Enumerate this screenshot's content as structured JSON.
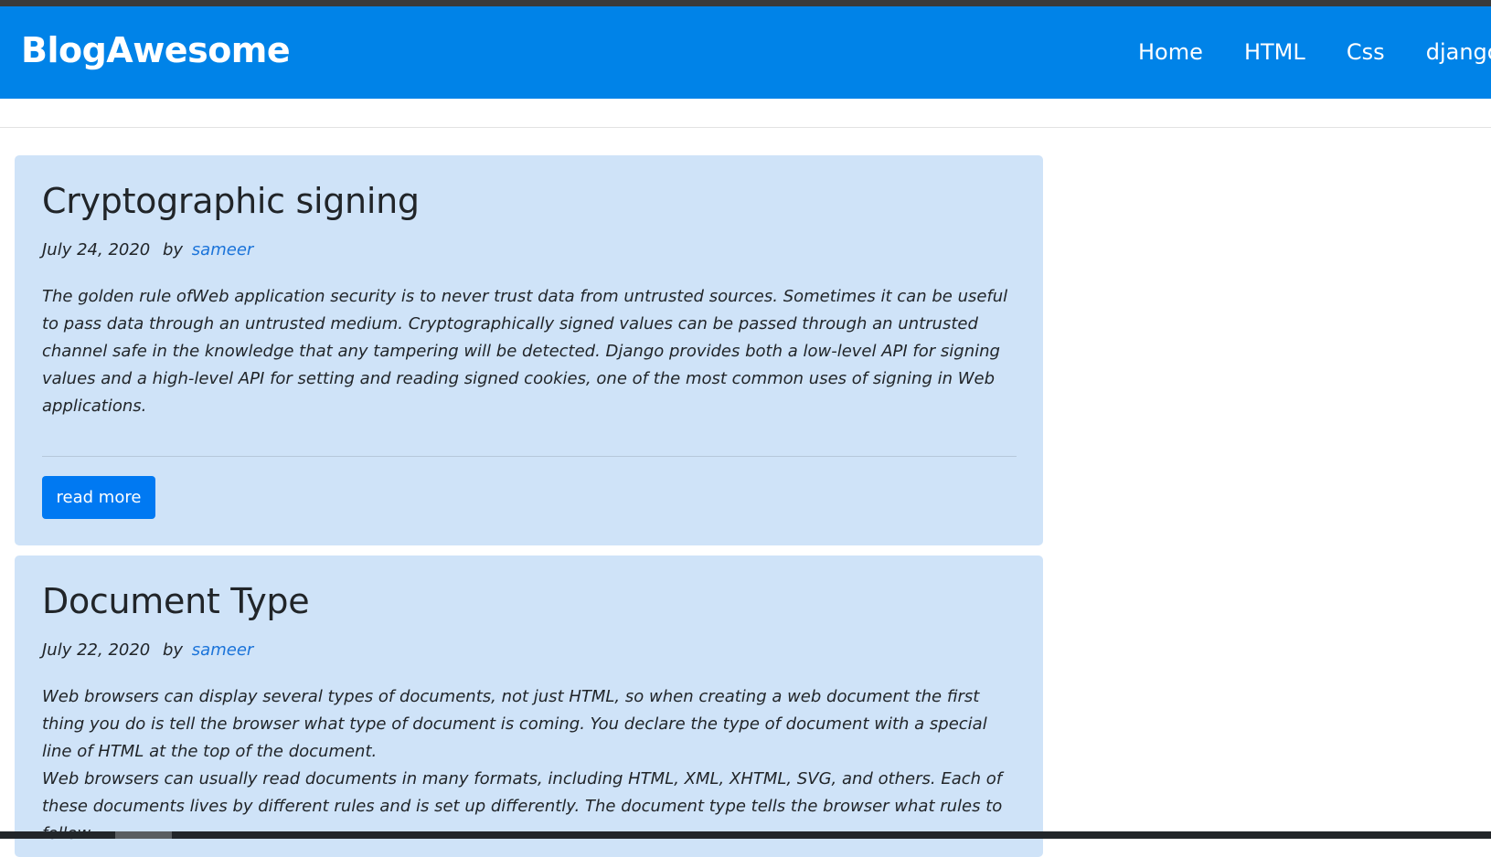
{
  "brand": "BlogAwesome",
  "nav": [
    "Home",
    "HTML",
    "Css",
    "django"
  ],
  "posts": [
    {
      "title": "Cryptographic signing",
      "date": "July 24, 2020",
      "by": "by",
      "author": "sameer",
      "paragraphs": [
        "The golden rule ofWeb application security is to never trust data from untrusted sources. Sometimes it can be useful to pass data through an untrusted medium. Cryptographically signed values can be passed through an untrusted channel safe in the knowledge that any tampering will be detected. Django provides both a low-level API for signing values and a high-level API for setting and reading signed cookies, one of the most common uses of signing in Web applications."
      ],
      "button": "read more"
    },
    {
      "title": "Document Type",
      "date": "July 22, 2020",
      "by": "by",
      "author": "sameer",
      "paragraphs": [
        "Web browsers can display several types of documents, not just HTML, so when creating a web document the first thing you do is tell the browser what type of document is coming. You declare the type of document with a special line of HTML at the top of the document.",
        "Web browsers can usually read documents in many formats, including HTML, XML, XHTML, SVG, and others. Each of these documents lives by different rules and is set up differently. The document type tells the browser what rules to follow"
      ]
    }
  ]
}
